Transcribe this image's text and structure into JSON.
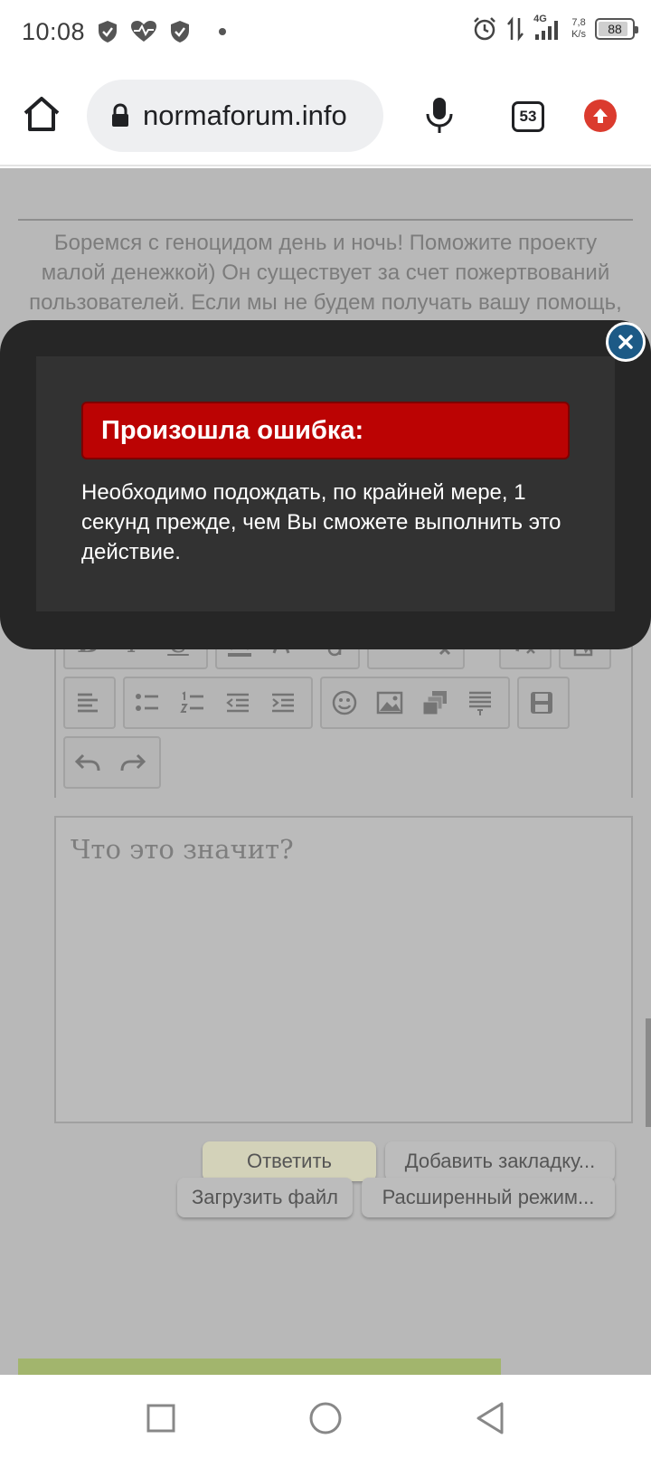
{
  "status_bar": {
    "time": "10:08",
    "network": "4G",
    "speed_value": "7,8",
    "speed_unit": "K/s",
    "battery": "88",
    "battery_level_percent": 88
  },
  "browser": {
    "url": "normaforum.info",
    "tab_count": "53"
  },
  "page": {
    "donate_text": "Боремся с геноцидом день и ночь! Поможите проекту малой денежкой) Он существует за счет пожертвований пользователей. Если мы не будем получать вашу помощь, то не сможем обеспечить постоянные, бесплатные консультации родственникам и наркоманам. Даже 100 рублей - уже помощь. Мы будем благодарны за каждого сайта! Актуальные реквизиты для перевода спрашивайте у команды форума",
    "editor_placeholder": "Что это значит?",
    "buttons": {
      "reply": "Ответить",
      "bookmark": "Добавить закладку...",
      "upload": "Загрузить файл",
      "advanced": "Расширенный режим..."
    }
  },
  "modal": {
    "title": "Произошла ошибка:",
    "message": "Необходимо подождать, по крайней мере, 1 секунд прежде, чем Вы сможете выполнить это действие."
  },
  "icons": {
    "status": [
      "shield-icon",
      "heartbeat-icon",
      "shield-icon",
      "dot-icon"
    ],
    "status_right": [
      "alarm-icon",
      "data-arrows-icon",
      "signal-icon",
      "battery-icon"
    ],
    "browser": [
      "home-icon",
      "lock-icon",
      "mic-icon",
      "tabs-icon",
      "update-icon"
    ],
    "toolbar": [
      "bold-icon",
      "italic-icon",
      "underline-icon",
      "font-color-icon",
      "font-size-icon",
      "font-case-icon",
      "link-icon",
      "unlink-icon",
      "clear-format-icon",
      "source-icon",
      "align-left-icon",
      "bullet-list-icon",
      "number-list-icon",
      "outdent-icon",
      "indent-icon",
      "smiley-icon",
      "image-icon",
      "media-icon",
      "quote-icon",
      "save-icon",
      "undo-icon",
      "redo-icon"
    ],
    "nav": [
      "recents-icon",
      "home-circle-icon",
      "back-icon"
    ]
  },
  "colors": {
    "modal_header": "#bb0303",
    "close_button": "#1d5a86",
    "update_badge": "#db3b2e",
    "page_overlay": "#b8b8b8"
  }
}
